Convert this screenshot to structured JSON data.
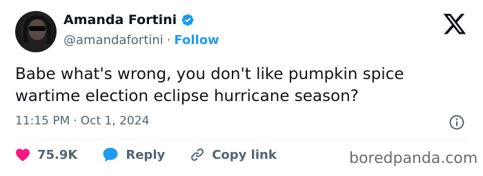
{
  "author": {
    "display_name": "Amanda Fortini",
    "handle": "@amandafortini",
    "separator": "·",
    "follow_label": "Follow"
  },
  "tweet": {
    "text": "Babe what's wrong, you don't like pumpkin spice wartime election eclipse hurricane season?",
    "time": "11:15 PM",
    "date_separator": "·",
    "date": "Oct 1, 2024"
  },
  "actions": {
    "likes": "75.9K",
    "reply_label": "Reply",
    "copy_link_label": "Copy link"
  },
  "watermark": "boredpanda.com",
  "colors": {
    "like": "#f91880",
    "reply": "#1d9bf0",
    "verified": "#1d9bf0",
    "follow": "#1d9bf0",
    "secondary_text": "#536471"
  },
  "icons": [
    "verified-badge-icon",
    "x-logo-icon",
    "info-icon",
    "heart-icon",
    "reply-bubble-icon",
    "link-icon"
  ]
}
